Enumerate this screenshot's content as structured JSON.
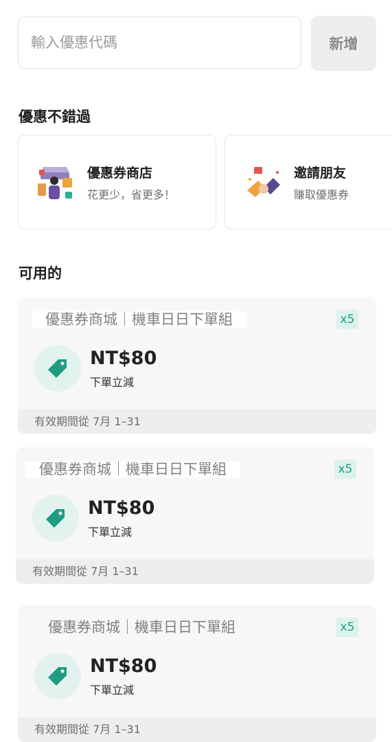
{
  "code_entry": {
    "placeholder": "輸入優惠代碼",
    "add_label": "新增"
  },
  "promos_section": {
    "title": "優惠不錯過",
    "cards": [
      {
        "title": "優惠券商店",
        "subtitle": "花更少，省更多！",
        "icon": "coupon-shop-icon"
      },
      {
        "title": "邀請朋友",
        "subtitle": "賺取優惠券",
        "icon": "invite-friends-icon"
      }
    ]
  },
  "available_section": {
    "title": "可用的",
    "coupons": [
      {
        "title": "優惠券商城｜機車日日下單組",
        "quantity": "x5",
        "amount": "NT$80",
        "description": "下單立減",
        "validity": "有效期間從 7月 1–31"
      },
      {
        "title": "優惠券商城｜機車日日下單組",
        "quantity": "x5",
        "amount": "NT$80",
        "description": "下單立減",
        "validity": "有效期間從 7月 1–31"
      },
      {
        "title": "優惠券商城｜機車日日下單組",
        "quantity": "x5",
        "amount": "NT$80",
        "description": "下單立減",
        "validity": "有效期間從 7月 1–31"
      }
    ]
  },
  "colors": {
    "accent": "#1f9c82",
    "badge_bg": "#dcf2ec",
    "tag_circle": "#e2f2ee",
    "card_bg": "#f7f7f7"
  }
}
